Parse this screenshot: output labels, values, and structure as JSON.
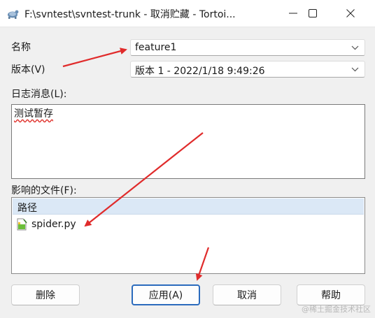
{
  "window": {
    "title": "F:\\svntest\\svntest-trunk - 取消贮藏 - Tortoi...",
    "app_icon": "tortoise-svn-icon"
  },
  "form": {
    "name_label": "名称",
    "name_value": "feature1",
    "version_label": "版本(V)",
    "version_value": "版本 1 - 2022/1/18 9:49:26",
    "log_label": "日志消息(L):",
    "log_message": "测试暂存",
    "files_label": "影响的文件(F):"
  },
  "file_list": {
    "header": "路径",
    "items": [
      {
        "name": "spider.py",
        "icon": "python-file-icon"
      }
    ]
  },
  "buttons": {
    "delete": "删除",
    "apply": "应用(A)",
    "cancel": "取消",
    "help": "帮助"
  },
  "annotation_color": "#e02b2b",
  "watermark": "@稀土掘金技术社区"
}
